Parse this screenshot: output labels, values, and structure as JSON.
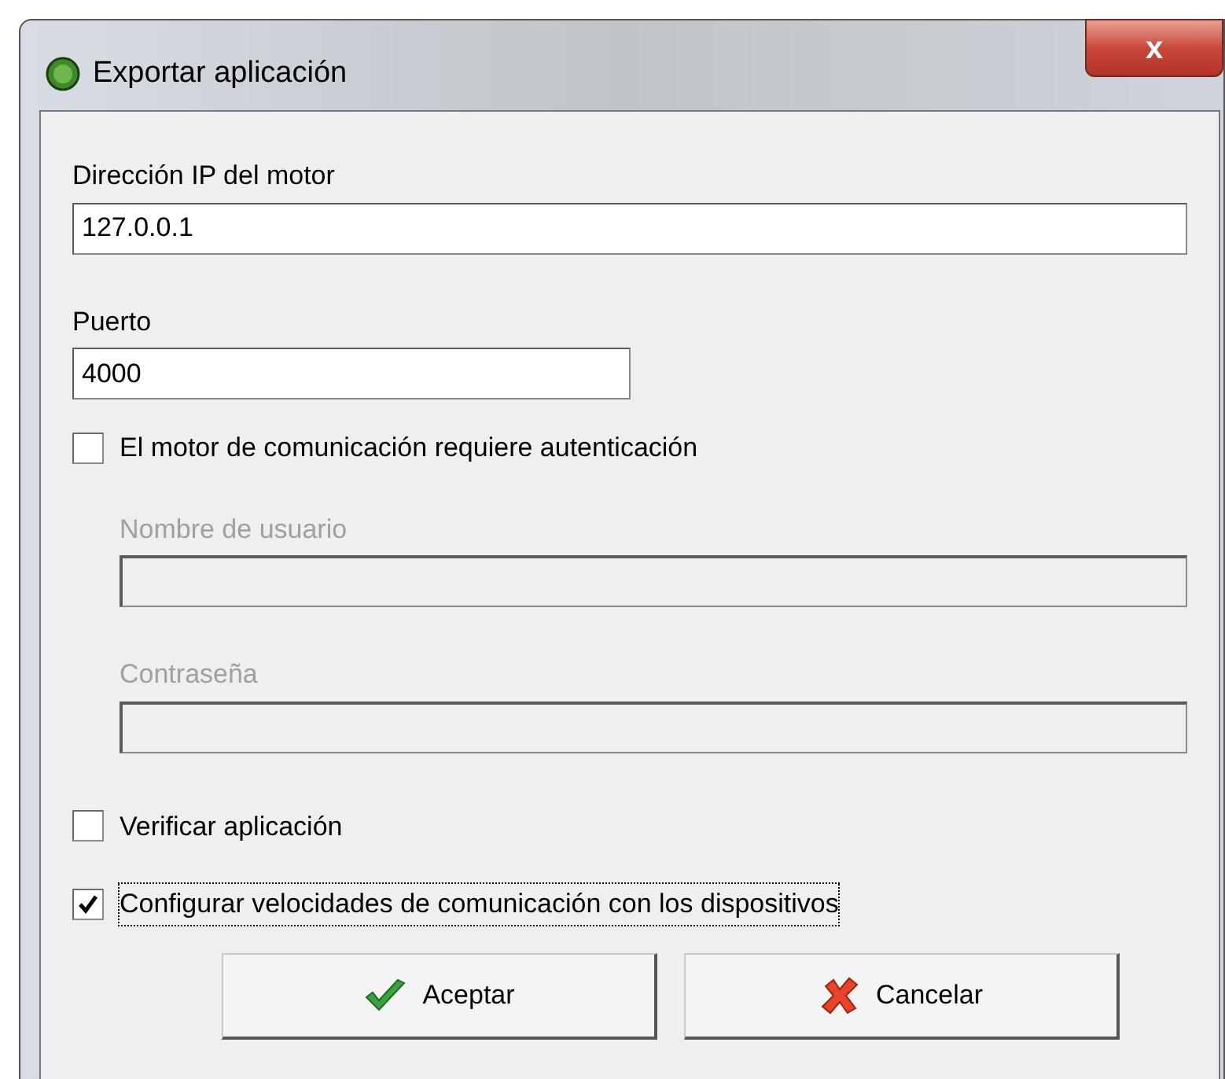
{
  "window": {
    "title": "Exportar aplicación",
    "close_label": "x"
  },
  "fields": [
    {
      "label": "Dirección IP del motor",
      "value": "127.0.0.1",
      "disabled": false
    },
    {
      "label": "Puerto",
      "value": "4000",
      "disabled": false
    }
  ],
  "auth_checkbox": {
    "label": "El motor de comunicación requiere autenticación",
    "checked": false,
    "focused": false
  },
  "auth_fields": [
    {
      "label": "Nombre de usuario",
      "disabled": true
    },
    {
      "label": "Contraseña",
      "disabled": true
    }
  ],
  "options": [
    {
      "label": "Verificar aplicación",
      "checked": false,
      "focused": false
    },
    {
      "label": "Configurar velocidades de comunicación con los dispositivos",
      "checked": true,
      "focused": true
    }
  ],
  "buttons": [
    {
      "label": "Aceptar",
      "kind": "ok"
    },
    {
      "label": "Cancelar",
      "kind": "cancel"
    }
  ]
}
